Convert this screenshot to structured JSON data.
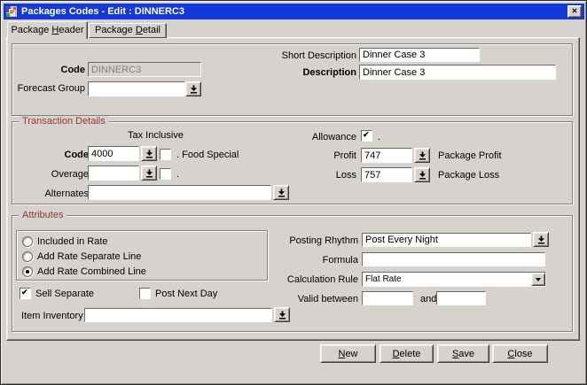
{
  "colors": {
    "titlebar_blue": "#1339dc",
    "section_title_maroon": "#9a3432",
    "window_background": "#d6d3ce"
  },
  "window": {
    "title": "Packages Codes - Edit : DINNERC3",
    "close_glyph": "✕"
  },
  "icons": {
    "app_icon": "form-app-icon",
    "close": "x-mark",
    "lov_button": "down-arrow-to-bar",
    "combo_arrow": "black-down-triangle"
  },
  "tabs": [
    {
      "pre": "Package ",
      "key": "H",
      "post": "eader",
      "active": true
    },
    {
      "pre": "Package ",
      "key": "D",
      "post": "etail",
      "active": false
    }
  ],
  "header": {
    "code_label": "Code",
    "code_value": "DINNERC3",
    "forecast_group_label": "Forecast Group",
    "forecast_group_value": "",
    "short_description_label": "Short Description",
    "short_description_value": "Dinner Case 3",
    "description_label": "Description",
    "description_value": "Dinner Case 3"
  },
  "transaction_details": {
    "title": "Transaction Details",
    "tax_inclusive_label": "Tax Inclusive",
    "code_label": "Code",
    "code_value": "4000",
    "food_special_checked": false,
    "food_special_label": ". Food Special",
    "overage_label": "Overage",
    "overage_value": "",
    "overage_checked": false,
    "overage_suffix": ".",
    "alternates_label": "Alternates",
    "alternates_value": "",
    "allowance_label": "Allowance",
    "allowance_checked": true,
    "allowance_suffix": ".",
    "profit_label": "Profit",
    "profit_value": "747",
    "package_profit_label": "Package Profit",
    "loss_label": "Loss",
    "loss_value": "757",
    "package_loss_label": "Package Loss"
  },
  "attributes": {
    "title": "Attributes",
    "radio_options": [
      "Included in Rate",
      "Add Rate Separate Line",
      "Add Rate Combined Line"
    ],
    "radio_selected": [
      false,
      false,
      true
    ],
    "selected_radio": "Add Rate Combined Line",
    "sell_separate_label": "Sell Separate",
    "sell_separate_checked": true,
    "post_next_day_label": "Post Next Day",
    "post_next_day_checked": false,
    "item_inventory_label": "Item Inventory",
    "item_inventory_value": "",
    "posting_rhythm_label": "Posting Rhythm",
    "posting_rhythm_value": "Post Every Night",
    "formula_label": "Formula",
    "formula_value": "",
    "calculation_rule_label": "Calculation Rule",
    "calculation_rule_value": "Flat Rate",
    "valid_between_label": "Valid between",
    "valid_from_value": "",
    "and_label": "and",
    "valid_to_value": ""
  },
  "buttons": [
    {
      "pre": "",
      "key": "N",
      "post": "ew"
    },
    {
      "pre": "",
      "key": "D",
      "post": "elete"
    },
    {
      "pre": "",
      "key": "S",
      "post": "ave"
    },
    {
      "pre": "",
      "key": "C",
      "post": "lose"
    }
  ]
}
